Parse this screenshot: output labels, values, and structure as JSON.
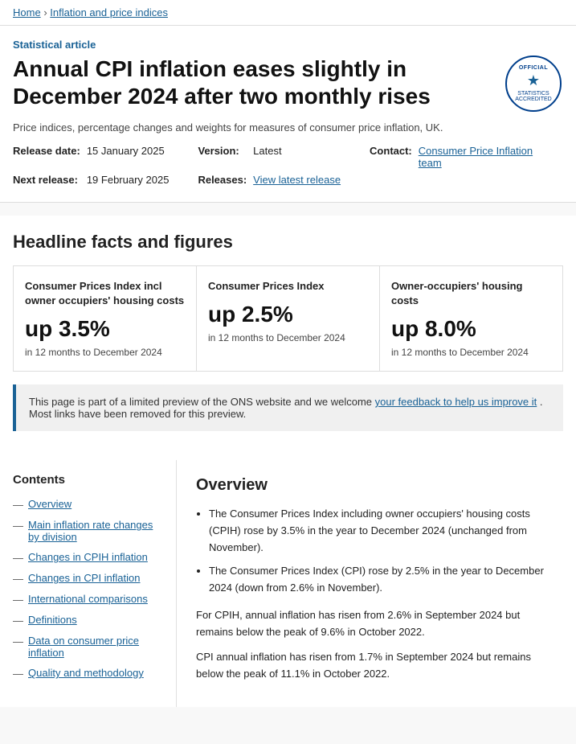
{
  "breadcrumb": {
    "home": "Home",
    "section": "Inflation and price indices"
  },
  "header": {
    "statistical_label": "Statistical article",
    "title": "Annual CPI inflation eases slightly in December 2024 after two monthly rises",
    "subtitle": "Price indices, percentage changes and weights for measures of consumer price inflation, UK.",
    "badge": {
      "top": "OFFICIAL",
      "middle": "★",
      "bottom": "STATISTICS\nAccredited"
    },
    "release_label": "Release date:",
    "release_date": "15 January 2025",
    "version_label": "Version:",
    "version_value": "Latest",
    "contact_label": "Contact:",
    "contact_link": "Consumer Price Inflation team",
    "next_release_label": "Next release:",
    "next_release_date": "19 February 2025",
    "releases_label": "Releases:",
    "releases_link": "View latest release"
  },
  "headline": {
    "title": "Headline facts and figures",
    "cards": [
      {
        "title": "Consumer Prices Index incl owner occupiers' housing costs",
        "value": "up 3.5%",
        "desc": "in 12 months to December 2024"
      },
      {
        "title": "Consumer Prices Index",
        "value": "up 2.5%",
        "desc": "in 12 months to December 2024"
      },
      {
        "title": "Owner-occupiers' housing costs",
        "value": "up 8.0%",
        "desc": "in 12 months to December 2024"
      }
    ]
  },
  "preview_banner": {
    "text_before": "This page is part of a limited preview of the ONS website and we welcome ",
    "link_text": "your feedback to help us improve it",
    "text_after": " . Most links have been removed for this preview."
  },
  "contents": {
    "title": "Contents",
    "items": [
      {
        "label": "Overview",
        "href": "#overview"
      },
      {
        "label": "Main inflation rate changes by division",
        "href": "#main-inflation"
      },
      {
        "label": "Changes in CPIH inflation",
        "href": "#cpih"
      },
      {
        "label": "Changes in CPI inflation",
        "href": "#cpi"
      },
      {
        "label": "International comparisons",
        "href": "#international"
      },
      {
        "label": "Definitions",
        "href": "#definitions"
      },
      {
        "label": "Data on consumer price inflation",
        "href": "#data"
      },
      {
        "label": "Quality and methodology",
        "href": "#quality"
      }
    ]
  },
  "overview": {
    "title": "Overview",
    "bullets": [
      "The Consumer Prices Index including owner occupiers' housing costs (CPIH) rose by 3.5% in the year to December 2024 (unchanged from November).",
      "The Consumer Prices Index (CPI) rose by 2.5% in the year to December 2024 (down from 2.6% in November)."
    ],
    "paragraphs": [
      "For CPIH, annual inflation has risen from 2.6% in September 2024 but remains below the peak of 9.6% in October 2022.",
      "CPI annual inflation has risen from 1.7% in September 2024 but remains below the peak of 11.1% in October 2022."
    ]
  }
}
